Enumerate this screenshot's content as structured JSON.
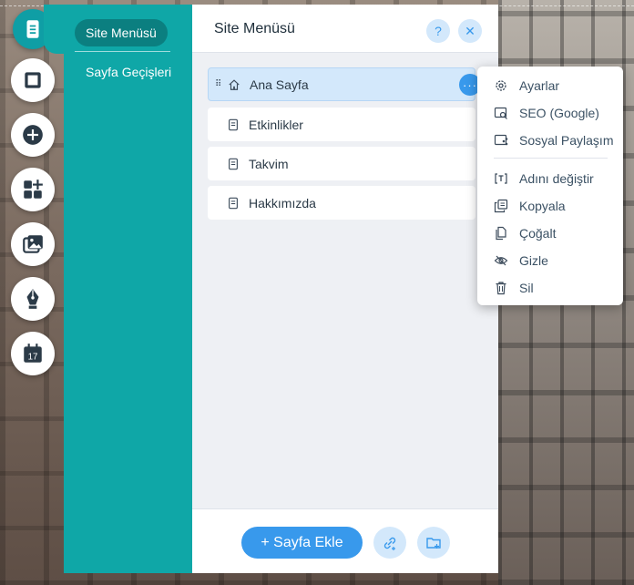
{
  "sidebar": {
    "items": [
      {
        "label": "Site Menüsü",
        "selected": true
      },
      {
        "label": "Sayfa Geçişleri",
        "selected": false
      }
    ]
  },
  "toolbar": {
    "tools": [
      "pages-icon",
      "background-icon",
      "add-icon",
      "apps-icon",
      "media-icon",
      "pen-icon",
      "calendar-icon"
    ],
    "calendar_day": "17"
  },
  "panel": {
    "title": "Site Menüsü",
    "help_label": "?",
    "close_label": "✕",
    "more_label": "···",
    "pages": [
      {
        "label": "Ana Sayfa",
        "home": true,
        "selected": true
      },
      {
        "label": "Etkinlikler",
        "home": false,
        "selected": false
      },
      {
        "label": "Takvim",
        "home": false,
        "selected": false
      },
      {
        "label": "Hakkımızda",
        "home": false,
        "selected": false
      }
    ],
    "add_page_label": "+ Sayfa Ekle"
  },
  "context_menu": {
    "items": [
      {
        "label": "Ayarlar",
        "icon": "gear-icon"
      },
      {
        "label": "SEO (Google)",
        "icon": "seo-icon"
      },
      {
        "label": "Sosyal Paylaşım",
        "icon": "share-icon"
      },
      {
        "label": "Adını değiştir",
        "icon": "rename-icon"
      },
      {
        "label": "Kopyala",
        "icon": "copy-icon"
      },
      {
        "label": "Çoğalt",
        "icon": "duplicate-icon"
      },
      {
        "label": "Gizle",
        "icon": "hide-icon"
      },
      {
        "label": "Sil",
        "icon": "trash-icon"
      }
    ]
  },
  "colors": {
    "teal": "#0fa7a7",
    "accent": "#3899ec",
    "selected_row": "#d3e8fb"
  }
}
